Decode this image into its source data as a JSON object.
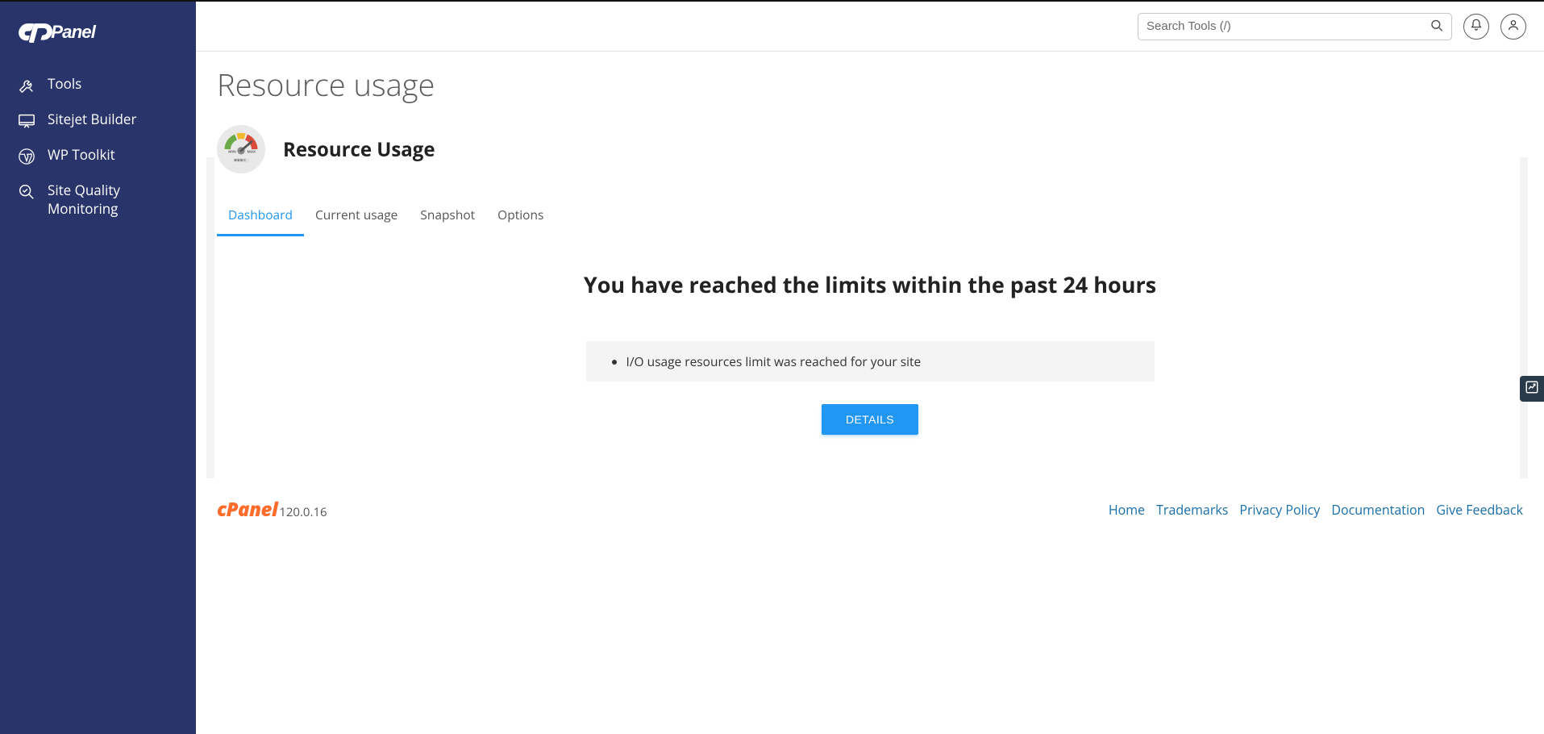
{
  "sidebar": {
    "items": [
      {
        "label": "Tools"
      },
      {
        "label": "Sitejet Builder"
      },
      {
        "label": "WP Toolkit"
      },
      {
        "label": "Site Quality Monitoring"
      }
    ]
  },
  "header": {
    "search_placeholder": "Search Tools (/)"
  },
  "page": {
    "title": "Resource usage",
    "panel_title": "Resource Usage",
    "tabs": [
      {
        "label": "Dashboard",
        "active": true
      },
      {
        "label": "Current usage",
        "active": false
      },
      {
        "label": "Snapshot",
        "active": false
      },
      {
        "label": "Options",
        "active": false
      }
    ],
    "headline": "You have reached the limits within the past 24 hours",
    "alerts": [
      "I/O usage resources limit was reached for your site"
    ],
    "details_label": "DETAILS"
  },
  "footer": {
    "version": "120.0.16",
    "links": [
      "Home",
      "Trademarks",
      "Privacy Policy",
      "Documentation",
      "Give Feedback"
    ]
  }
}
